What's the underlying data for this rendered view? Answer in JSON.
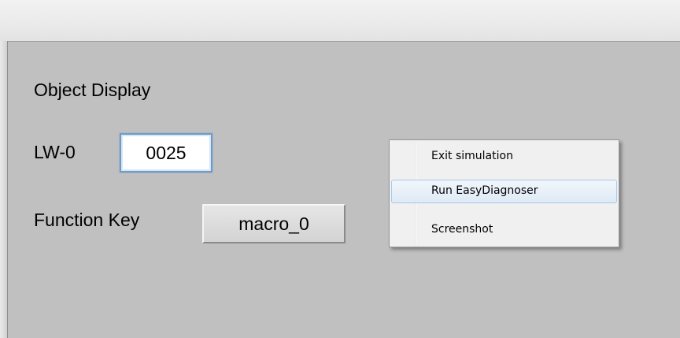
{
  "client": {
    "title": "Object Display",
    "numeric_display": {
      "label": "LW-0",
      "value": "0025"
    },
    "function_key": {
      "label": "Function Key",
      "button_label": "macro_0"
    }
  },
  "context_menu": {
    "items": [
      {
        "label": "Exit simulation"
      },
      {
        "label": "Run EasyDiagnoser",
        "highlighted": true
      },
      {
        "label": "Screenshot"
      }
    ]
  },
  "colors": {
    "client_background": "#c0c0c0",
    "menu_highlight_border": "#a8c8ea",
    "numeric_border": "#6f9bc6"
  }
}
